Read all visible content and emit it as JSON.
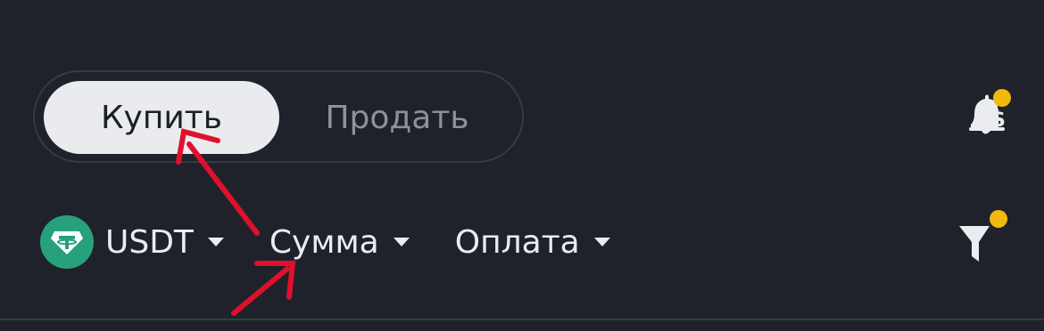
{
  "trade_toggle": {
    "buy_label": "Купить",
    "sell_label": "Продать",
    "active": "buy"
  },
  "filters": {
    "token": {
      "label": "USDT",
      "icon": "tether-icon"
    },
    "amount": {
      "label": "Сумма"
    },
    "payment": {
      "label": "Оплата"
    }
  },
  "icons": {
    "notification": "bell-dollar-icon",
    "filter": "funnel-icon"
  },
  "colors": {
    "background": "#1f222b",
    "active_tab": "#eaebee",
    "inactive_text": "#8c919b",
    "badge": "#f0b90b",
    "tether": "#26a17b",
    "annotation": "#e0102d"
  }
}
